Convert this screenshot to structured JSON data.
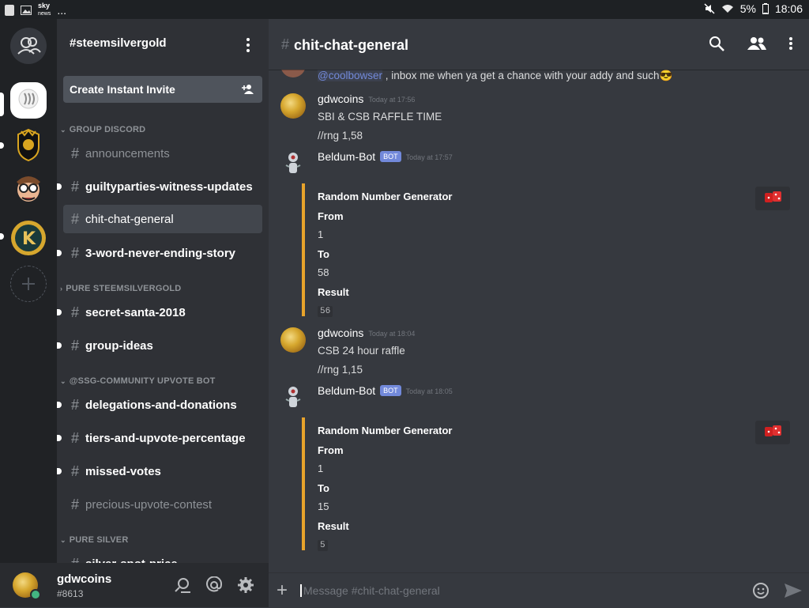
{
  "status_bar": {
    "sky_label": "sky",
    "news_label": "news",
    "overflow": "...",
    "battery": "5%",
    "time": "18:06"
  },
  "guild": {
    "name": "#steemsilvergold",
    "invite_label": "Create Instant Invite"
  },
  "categories": [
    {
      "label": "GROUP DISCORD"
    },
    {
      "label": "PURE STEEMSILVERGOLD"
    },
    {
      "label": "@SSG-COMMUNITY  UPVOTE BOT"
    },
    {
      "label": "PURE SILVER"
    }
  ],
  "channels": [
    {
      "name": "announcements"
    },
    {
      "name": "guiltyparties-witness-updates"
    },
    {
      "name": "chit-chat-general"
    },
    {
      "name": "3-word-never-ending-story"
    },
    {
      "name": "secret-santa-2018"
    },
    {
      "name": "group-ideas"
    },
    {
      "name": "delegations-and-donations"
    },
    {
      "name": "tiers-and-upvote-percentage"
    },
    {
      "name": "missed-votes"
    },
    {
      "name": "precious-upvote-contest"
    },
    {
      "name": "silver-spot-price"
    }
  ],
  "user": {
    "name": "gdwcoins",
    "tag": "#8613"
  },
  "chat": {
    "channel_title": "chit-chat-general",
    "top_partial": {
      "mention": "@coolbowser",
      "text": " , inbox me when ya get a chance with your addy and such",
      "emoji": "😎"
    },
    "messages": [
      {
        "author": "gdwcoins",
        "timestamp": "Today at 17:56",
        "lines": [
          "SBI & CSB RAFFLE TIME",
          "//rng 1,58"
        ]
      },
      {
        "author": "Beldum-Bot",
        "bot_tag": "BOT",
        "timestamp": "Today at 17:57",
        "embed": {
          "title": "Random Number Generator",
          "from_label": "From",
          "from_value": "1",
          "to_label": "To",
          "to_value": "58",
          "result_label": "Result",
          "result_value": "56"
        }
      },
      {
        "author": "gdwcoins",
        "timestamp": "Today at 18:04",
        "lines": [
          "CSB 24 hour raffle",
          "//rng 1,15"
        ]
      },
      {
        "author": "Beldum-Bot",
        "bot_tag": "BOT",
        "timestamp": "Today at 18:05",
        "embed": {
          "title": "Random Number Generator",
          "from_label": "From",
          "from_value": "1",
          "to_label": "To",
          "to_value": "15",
          "result_label": "Result",
          "result_value": "5"
        }
      }
    ],
    "composer_placeholder": "Message #chit-chat-general"
  },
  "colors": {
    "embed_accent": "#e8a32b",
    "bot_tag": "#7289da",
    "mention": "#7289da",
    "online": "#43b581"
  },
  "icons": [
    "search-icon",
    "members-icon",
    "kebab-menu-icon",
    "add-user-icon",
    "mentions-icon",
    "settings-icon",
    "discover-icon",
    "emoji-icon",
    "send-icon",
    "plus-icon",
    "mute-icon",
    "wifi-icon",
    "battery-icon"
  ]
}
